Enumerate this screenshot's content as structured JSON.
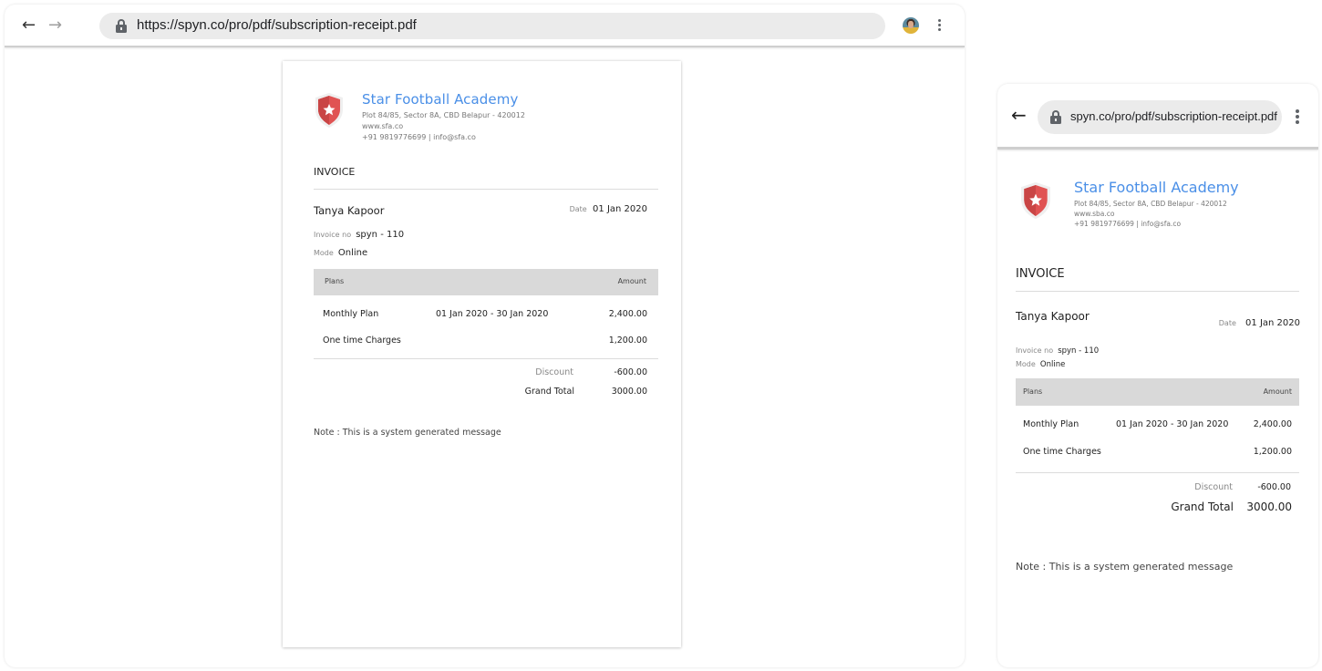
{
  "desktop": {
    "browser": {
      "url": "https://spyn.co/pro/pdf/subscription-receipt.pdf",
      "icons": [
        "back-arrow-icon",
        "forward-arrow-icon",
        "lock-icon",
        "profile-avatar",
        "more-vert-icon"
      ]
    },
    "invoice": {
      "org": {
        "name": "Star Football Academy",
        "address": "Plot 84/85, Sector 8A, CBD Belapur - 420012",
        "website": "www.sfa.co",
        "contact": "+91 9819776699 | info@sfa.co",
        "logo_icon": "shield-star-icon",
        "brand_color": "#4a8fe7",
        "logo_color": "#e24b4b"
      },
      "title": "INVOICE",
      "customer_name": "Tanya Kapoor",
      "date_label": "Date",
      "date_value": "01 Jan 2020",
      "invoice_no_label": "Invoice no",
      "invoice_no_value": "spyn - 110",
      "mode_label": "Mode",
      "mode_value": "Online",
      "table": {
        "headers": {
          "plans": "Plans",
          "amount": "Amount"
        },
        "rows": [
          {
            "plan": "Monthly Plan",
            "period": "01 Jan 2020 - 30 Jan 2020",
            "amount": "2,400.00"
          },
          {
            "plan": "One time Charges",
            "period": "",
            "amount": "1,200.00"
          }
        ]
      },
      "discount_label": "Discount",
      "discount_value": "-600.00",
      "grand_total_label": "Grand Total",
      "grand_total_value": "3000.00",
      "note": "Note :  This is a system generated message"
    }
  },
  "mobile": {
    "browser": {
      "url": "spyn.co/pro/pdf/subscription-receipt.pdf",
      "icons": [
        "back-arrow-icon",
        "lock-icon",
        "more-vert-icon"
      ]
    },
    "invoice": {
      "org": {
        "name": "Star Football Academy",
        "address": "Plot 84/85, Sector 8A, CBD Belapur - 420012",
        "website": "www.sba.co",
        "contact": "+91 9819776699 | info@sfa.co"
      },
      "title": "INVOICE",
      "customer_name": "Tanya Kapoor",
      "date_label": "Date",
      "date_value": "01 Jan 2020",
      "invoice_no_label": "Invoice no",
      "invoice_no_value": "spyn - 110",
      "mode_label": "Mode",
      "mode_value": "Online",
      "table": {
        "headers": {
          "plans": "Plans",
          "amount": "Amount"
        },
        "rows": [
          {
            "plan": "Monthly Plan",
            "period": "01 Jan 2020 - 30 Jan 2020",
            "amount": "2,400.00"
          },
          {
            "plan": "One time Charges",
            "period": "",
            "amount": "1,200.00"
          }
        ]
      },
      "discount_label": "Discount",
      "discount_value": "-600.00",
      "grand_total_label": "Grand Total",
      "grand_total_value": "3000.00",
      "note": "Note :  This is a system generated message"
    }
  }
}
